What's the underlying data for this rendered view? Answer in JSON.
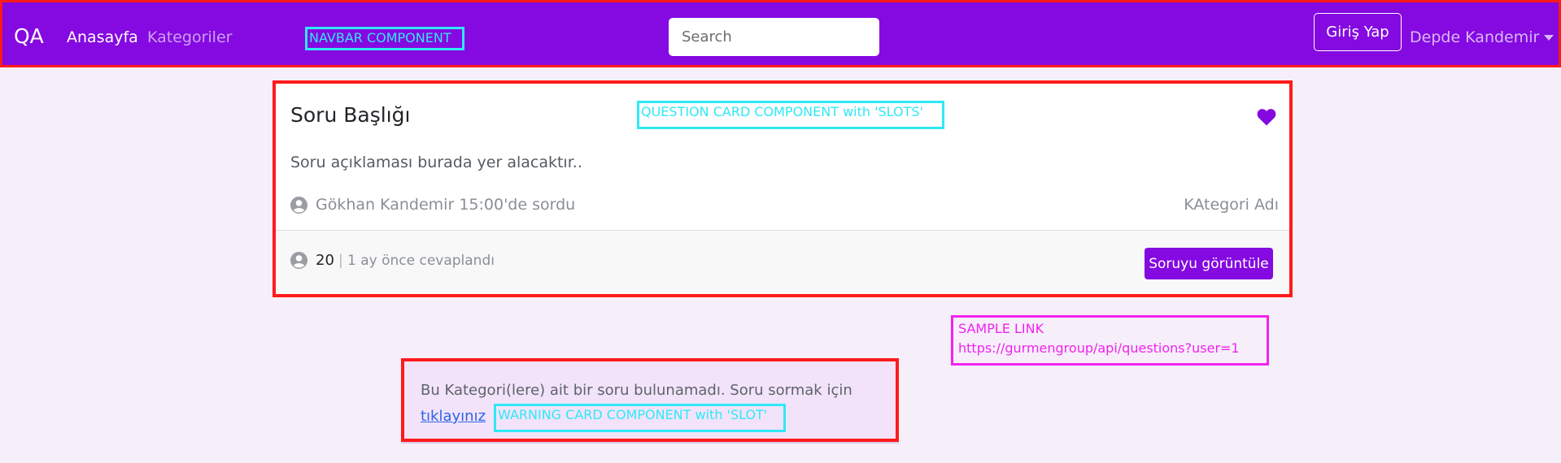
{
  "navbar": {
    "brand": "QA",
    "links": [
      {
        "label": "Anasayfa"
      },
      {
        "label": "Kategoriler"
      }
    ],
    "annotation": "NAVBAR COMPONENT",
    "search_placeholder": "Search",
    "login_label": "Giriş Yap",
    "user_name": "Depde Kandemir"
  },
  "question_card": {
    "title": "Soru Başlığı",
    "annotation": "QUESTION CARD COMPONENT with 'SLOTS'",
    "description": "Soru açıklaması burada yer alacaktır..",
    "author_line": "Gökhan Kandemir 15:00'de sordu",
    "category": "KAtegori Adı",
    "answer_count": "20",
    "separator": "|",
    "answered_time": "1 ay önce cevaplandı",
    "view_button": "Soruyu görüntüle"
  },
  "sample_link": {
    "label": "SAMPLE LINK",
    "url": "https://gurmengroup/api/questions?user=1"
  },
  "warning_card": {
    "text": "Bu Kategori(lere) ait bir soru bulunamadı. Soru sormak için",
    "link": "tıklayınız",
    "annotation": "WARNING CARD COMPONENT with 'SLOT'"
  },
  "colors": {
    "primary": "#8509e1",
    "annotation_outline": "#ff1a1a",
    "annotation_component": "#2fe9f6",
    "annotation_sample": "#f123f0",
    "link": "#2b65e7"
  },
  "icons": {
    "favorite": "heart-icon",
    "user": "user-circle-icon",
    "dropdown": "caret-down-icon"
  }
}
